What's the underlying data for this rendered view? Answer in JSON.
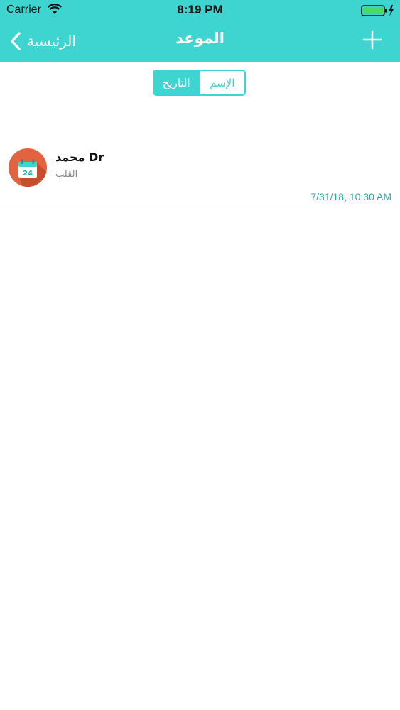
{
  "status_bar": {
    "carrier": "Carrier",
    "time": "8:19 PM"
  },
  "nav": {
    "back_label": "الرئيسية",
    "title": "الموعد"
  },
  "segment": {
    "date_label": "التاريخ",
    "name_label": "الإسم",
    "selected": "date_label"
  },
  "appointments": [
    {
      "title": "محمد Dr",
      "subtitle": "القلب",
      "datetime": "7/31/18, 10:30 AM",
      "icon_number": "24"
    }
  ],
  "colors": {
    "accent": "#3ED4CF",
    "avatar": "#E1633F",
    "time_text": "#2AA8A4"
  }
}
